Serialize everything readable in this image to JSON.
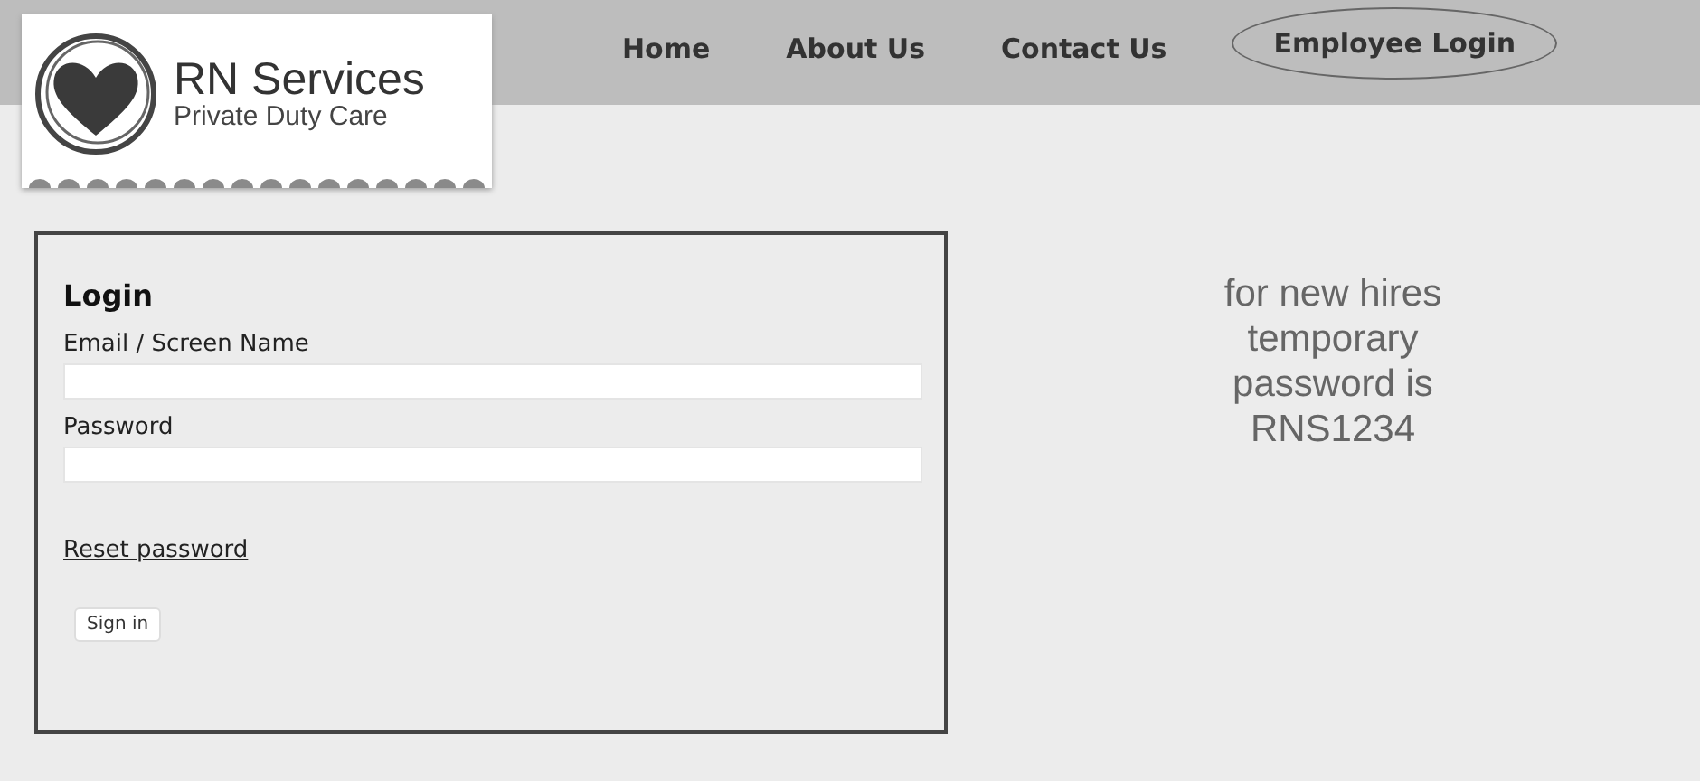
{
  "logo": {
    "title": "RN Services",
    "subtitle": "Private Duty Care"
  },
  "nav": [
    {
      "label": "Home",
      "selected": false
    },
    {
      "label": "About Us",
      "selected": false
    },
    {
      "label": "Contact Us",
      "selected": false
    },
    {
      "label": "Employee Login",
      "selected": true
    }
  ],
  "login": {
    "title": "Login",
    "fields": [
      {
        "label": "Email / Screen Name"
      },
      {
        "label": "Password"
      }
    ],
    "reset_link": "Reset password",
    "button": "Sign in"
  },
  "note": [
    "for new hires",
    "temporary",
    "password is",
    "RNS1234"
  ]
}
